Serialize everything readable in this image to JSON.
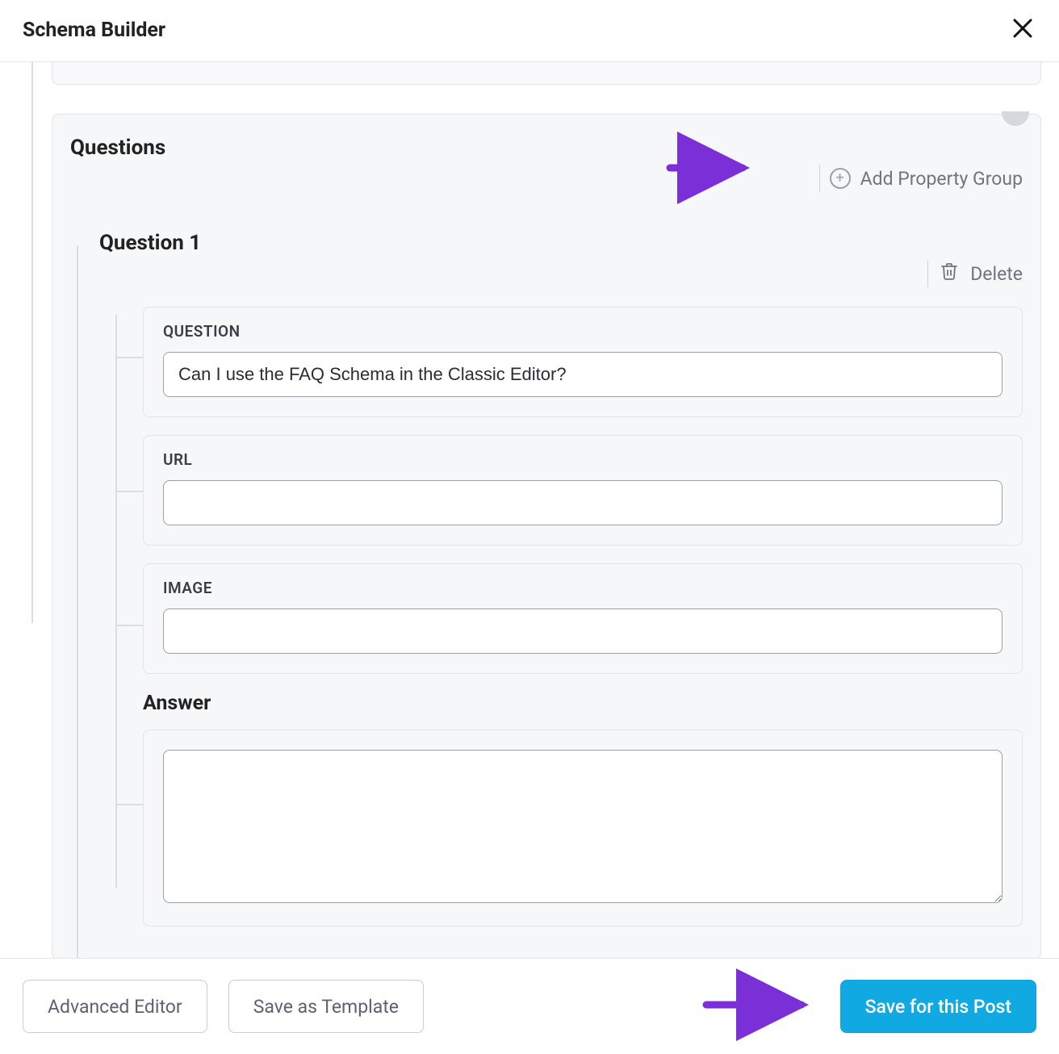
{
  "header": {
    "title": "Schema Builder"
  },
  "questions": {
    "title": "Questions",
    "add_group_label": "Add Property Group",
    "items": [
      {
        "title": "Question 1",
        "delete_label": "Delete",
        "fields": {
          "question_label": "QUESTION",
          "question_value": "Can I use the FAQ Schema in the Classic Editor?",
          "url_label": "URL",
          "url_value": "",
          "image_label": "IMAGE",
          "image_value": ""
        },
        "answer": {
          "title": "Answer",
          "value": ""
        }
      }
    ]
  },
  "footer": {
    "advanced_label": "Advanced Editor",
    "save_template_label": "Save as Template",
    "save_post_label": "Save for this Post"
  },
  "colors": {
    "primary": "#10a9e2",
    "annotation": "#7a2fd7"
  }
}
